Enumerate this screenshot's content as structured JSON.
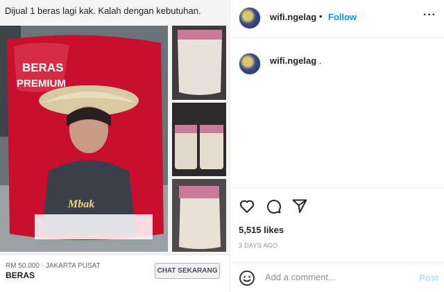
{
  "listing": {
    "caption": "Dijual 1 beras lagi kak. Kalah dengan kebutuhan.",
    "price_location": "RM 50.000 · JAKARTA PUSAT",
    "title": "BERAS",
    "chat_button": "CHAT SEKARANG",
    "bag_text_top": "BERAS",
    "bag_text_sub": "PREMIUM",
    "bag_text_bottom": "Mbak"
  },
  "post": {
    "username": "wifi.ngelag",
    "separator": "•",
    "follow_label": "Follow",
    "more_label": "···",
    "comment": {
      "username": "wifi.ngelag",
      "text": "."
    },
    "likes": "5,515 likes",
    "date": "3 DAYS AGO",
    "add_comment_placeholder": "Add a comment...",
    "post_label": "Post"
  },
  "icons": {
    "header_avatar": "avatar-image",
    "comment_avatar": "avatar-image",
    "like": "heart-icon",
    "comment": "comment-bubble-icon",
    "share": "paper-plane-icon",
    "emoji": "smiley-icon"
  },
  "colors": {
    "follow": "#0095f6",
    "post_disabled": "#b2dffc",
    "bag_red": "#c8102e"
  }
}
